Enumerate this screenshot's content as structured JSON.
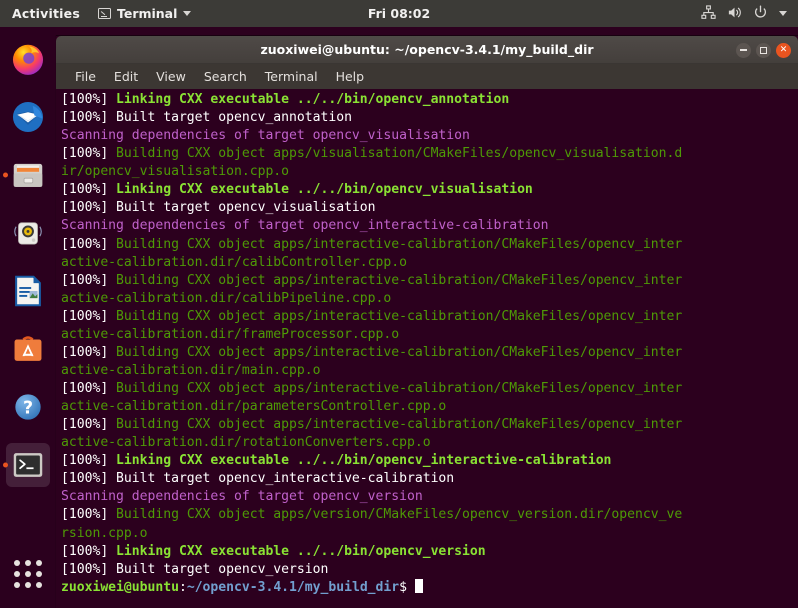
{
  "topbar": {
    "activities": "Activities",
    "app_name": "Terminal",
    "app_icon": "terminal-icon",
    "clock": "Fri 08:02",
    "tray_icons": [
      "network-icon",
      "volume-icon",
      "power-icon",
      "chevron-down-icon"
    ]
  },
  "dock": {
    "items": [
      {
        "name": "firefox",
        "label": "Firefox",
        "running": false
      },
      {
        "name": "thunderbird",
        "label": "Thunderbird Mail",
        "running": false
      },
      {
        "name": "files",
        "label": "Files",
        "running": true
      },
      {
        "name": "rhythmbox",
        "label": "Rhythmbox",
        "running": false
      },
      {
        "name": "libreoffice-writer",
        "label": "LibreOffice Writer",
        "running": false
      },
      {
        "name": "ubuntu-software",
        "label": "Ubuntu Software",
        "running": false
      },
      {
        "name": "help",
        "label": "Help",
        "running": false
      },
      {
        "name": "terminal",
        "label": "Terminal",
        "running": true
      }
    ],
    "show_apps_label": "Show Applications"
  },
  "window": {
    "title": "zuoxiwei@ubuntu: ~/opencv-3.4.1/my_build_dir",
    "buttons": {
      "minimize": "—",
      "maximize": "□",
      "close": "×"
    }
  },
  "menubar": {
    "items": [
      "File",
      "Edit",
      "View",
      "Search",
      "Terminal",
      "Help"
    ]
  },
  "terminal": {
    "colors": {
      "background": "#2c001e",
      "white": "#ffffff",
      "green": "#4e9a06",
      "bright_green": "#8ae234",
      "magenta": "#c061cb",
      "blue": "#729fcf"
    },
    "lines": [
      [
        {
          "t": "[100%] ",
          "c": "white"
        },
        {
          "t": "Linking CXX executable ../../bin/opencv_annotation",
          "c": "bgreen"
        }
      ],
      [
        {
          "t": "[100%] Built target opencv_annotation",
          "c": "white"
        }
      ],
      [
        {
          "t": "Scanning dependencies of target opencv_visualisation",
          "c": "magenta"
        }
      ],
      [
        {
          "t": "[100%] ",
          "c": "white"
        },
        {
          "t": "Building CXX object apps/visualisation/CMakeFiles/opencv_visualisation.d",
          "c": "green"
        }
      ],
      [
        {
          "t": "ir/opencv_visualisation.cpp.o",
          "c": "green"
        }
      ],
      [
        {
          "t": "[100%] ",
          "c": "white"
        },
        {
          "t": "Linking CXX executable ../../bin/opencv_visualisation",
          "c": "bgreen"
        }
      ],
      [
        {
          "t": "[100%] Built target opencv_visualisation",
          "c": "white"
        }
      ],
      [
        {
          "t": "Scanning dependencies of target opencv_interactive-calibration",
          "c": "magenta"
        }
      ],
      [
        {
          "t": "[100%] ",
          "c": "white"
        },
        {
          "t": "Building CXX object apps/interactive-calibration/CMakeFiles/opencv_inter",
          "c": "green"
        }
      ],
      [
        {
          "t": "active-calibration.dir/calibController.cpp.o",
          "c": "green"
        }
      ],
      [
        {
          "t": "[100%] ",
          "c": "white"
        },
        {
          "t": "Building CXX object apps/interactive-calibration/CMakeFiles/opencv_inter",
          "c": "green"
        }
      ],
      [
        {
          "t": "active-calibration.dir/calibPipeline.cpp.o",
          "c": "green"
        }
      ],
      [
        {
          "t": "[100%] ",
          "c": "white"
        },
        {
          "t": "Building CXX object apps/interactive-calibration/CMakeFiles/opencv_inter",
          "c": "green"
        }
      ],
      [
        {
          "t": "active-calibration.dir/frameProcessor.cpp.o",
          "c": "green"
        }
      ],
      [
        {
          "t": "[100%] ",
          "c": "white"
        },
        {
          "t": "Building CXX object apps/interactive-calibration/CMakeFiles/opencv_inter",
          "c": "green"
        }
      ],
      [
        {
          "t": "active-calibration.dir/main.cpp.o",
          "c": "green"
        }
      ],
      [
        {
          "t": "[100%] ",
          "c": "white"
        },
        {
          "t": "Building CXX object apps/interactive-calibration/CMakeFiles/opencv_inter",
          "c": "green"
        }
      ],
      [
        {
          "t": "active-calibration.dir/parametersController.cpp.o",
          "c": "green"
        }
      ],
      [
        {
          "t": "[100%] ",
          "c": "white"
        },
        {
          "t": "Building CXX object apps/interactive-calibration/CMakeFiles/opencv_inter",
          "c": "green"
        }
      ],
      [
        {
          "t": "active-calibration.dir/rotationConverters.cpp.o",
          "c": "green"
        }
      ],
      [
        {
          "t": "[100%] ",
          "c": "white"
        },
        {
          "t": "Linking CXX executable ../../bin/opencv_interactive-calibration",
          "c": "bgreen"
        }
      ],
      [
        {
          "t": "[100%] Built target opencv_interactive-calibration",
          "c": "white"
        }
      ],
      [
        {
          "t": "Scanning dependencies of target opencv_version",
          "c": "magenta"
        }
      ],
      [
        {
          "t": "[100%] ",
          "c": "white"
        },
        {
          "t": "Building CXX object apps/version/CMakeFiles/opencv_version.dir/opencv_ve",
          "c": "green"
        }
      ],
      [
        {
          "t": "rsion.cpp.o",
          "c": "green"
        }
      ],
      [
        {
          "t": "[100%] ",
          "c": "white"
        },
        {
          "t": "Linking CXX executable ../../bin/opencv_version",
          "c": "bgreen"
        }
      ],
      [
        {
          "t": "[100%] Built target opencv_version",
          "c": "white"
        }
      ]
    ],
    "prompt": {
      "user_host": "zuoxiwei@ubuntu",
      "separator": ":",
      "path": "~/opencv-3.4.1/my_build_dir",
      "sigil": "$",
      "command": "",
      "cursor": "block"
    }
  }
}
